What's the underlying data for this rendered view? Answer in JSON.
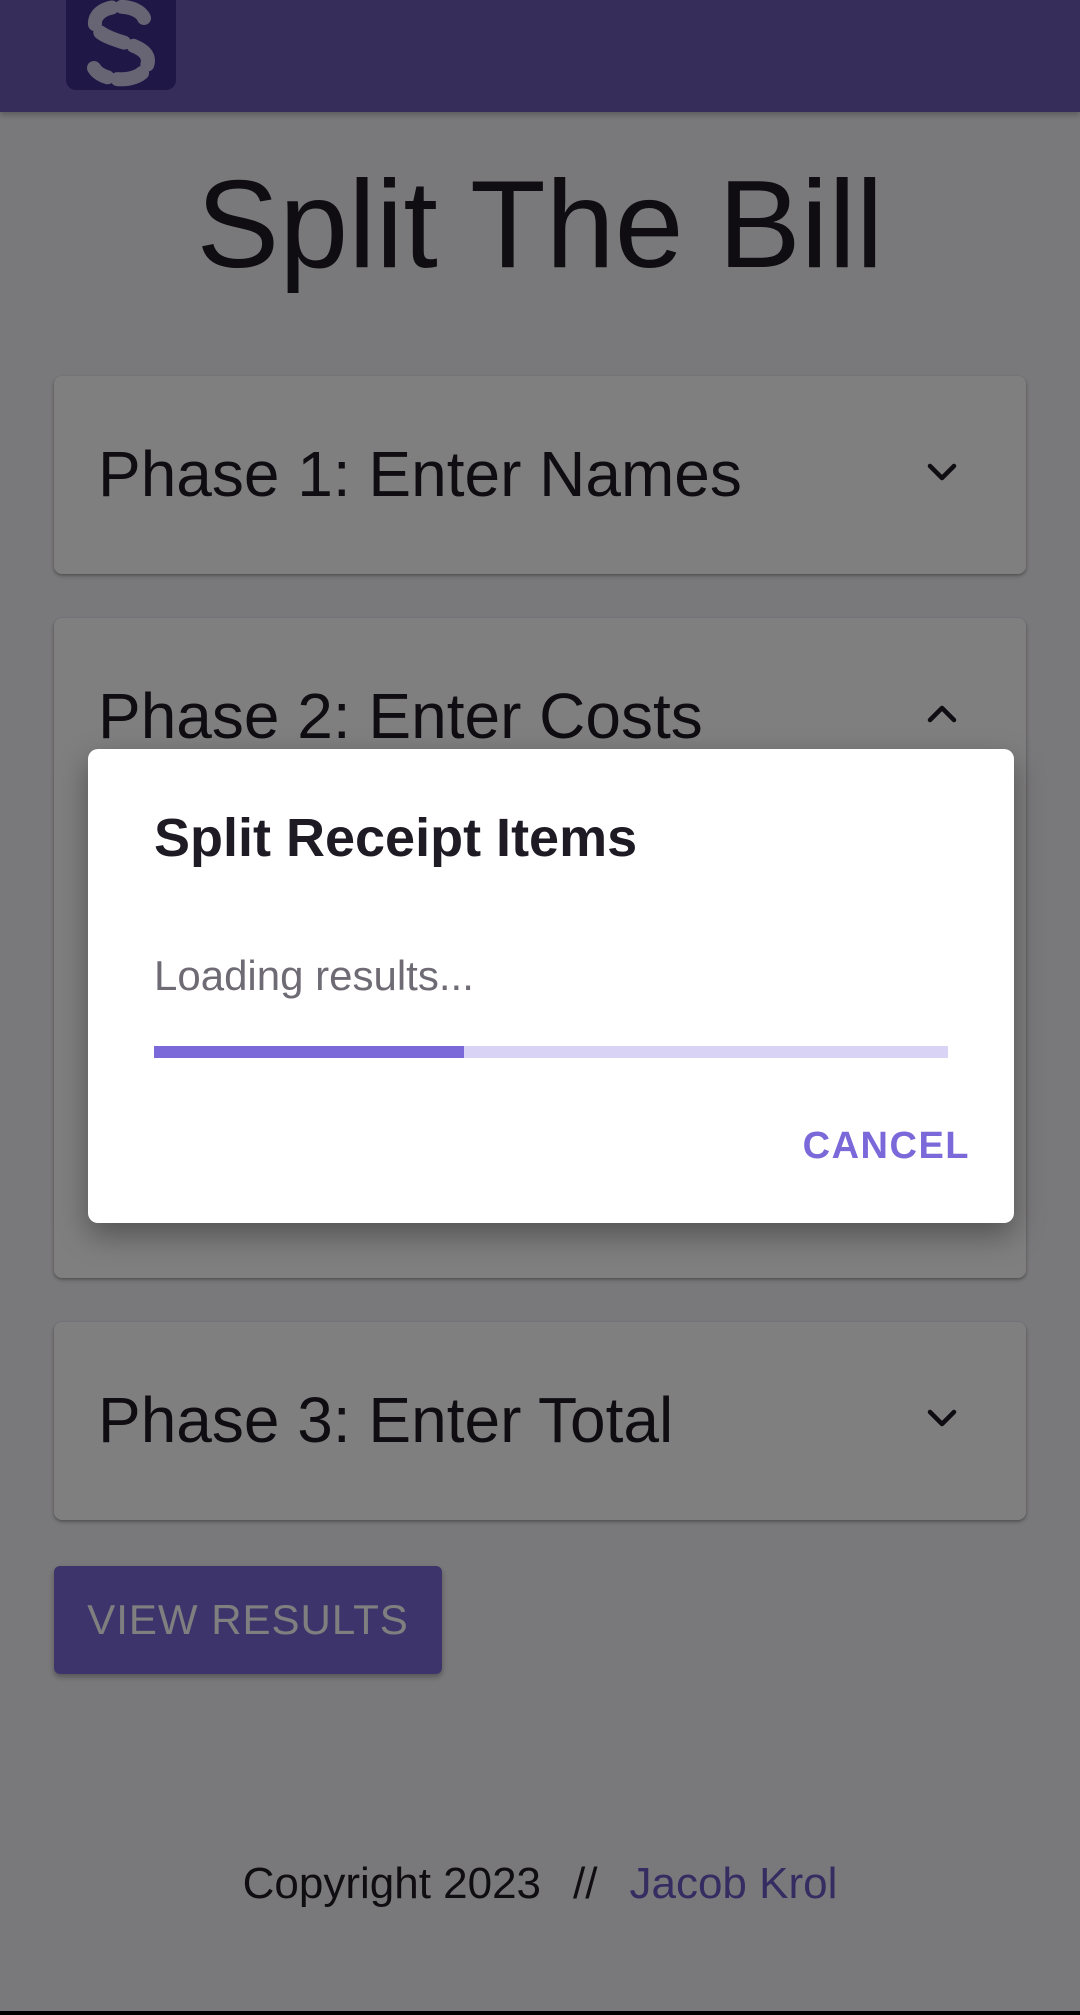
{
  "app": {
    "title": "Split The Bill",
    "logo_icon": "split-s-logo-icon"
  },
  "phases": [
    {
      "title": "Phase 1: Enter Names",
      "expanded": false
    },
    {
      "title": "Phase 2: Enter Costs",
      "expanded": true
    },
    {
      "title": "Phase 3: Enter Total",
      "expanded": false
    }
  ],
  "actions": {
    "view_results_label": "VIEW RESULTS"
  },
  "footer": {
    "copyright": "Copyright 2023",
    "separator": "//",
    "author": "Jacob Krol"
  },
  "dialog": {
    "title": "Split Receipt Items",
    "status": "Loading results...",
    "progress": 0.39,
    "cancel_label": "CANCEL"
  },
  "colors": {
    "primary": "#7b68d9",
    "app_bar": "#6c5bb6",
    "progress_track": "#d9d3f6"
  }
}
